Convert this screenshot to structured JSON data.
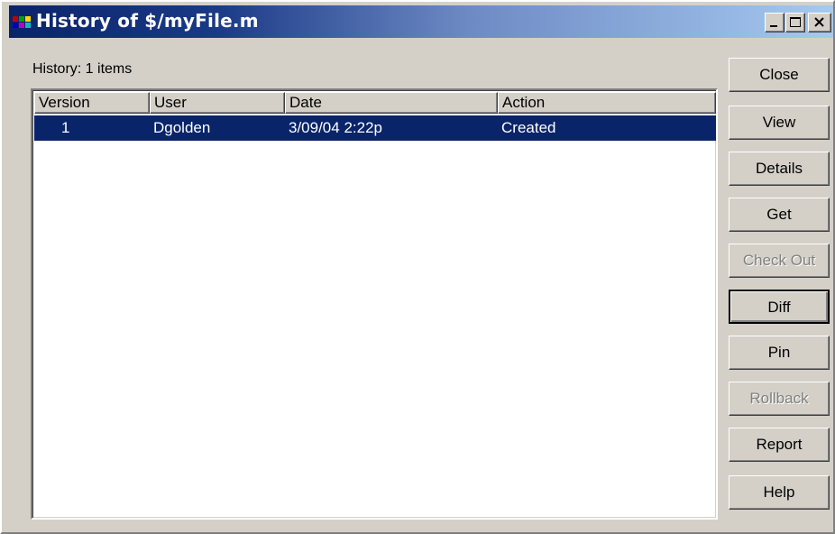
{
  "window": {
    "title": "History of $/myFile.m",
    "icon": "sourcesafe-app-icon"
  },
  "history": {
    "count_label": "History: 1 items"
  },
  "list": {
    "columns": [
      "Version",
      "User",
      "Date",
      "Action"
    ],
    "rows": [
      {
        "version": "1",
        "user": "Dgolden",
        "date": "3/09/04  2:22p",
        "action": "Created",
        "selected": true
      }
    ]
  },
  "buttons": {
    "close": "Close",
    "view": "View",
    "details": "Details",
    "get": "Get",
    "check_out": "Check Out",
    "diff": "Diff",
    "pin": "Pin",
    "rollback": "Rollback",
    "report": "Report",
    "help": "Help"
  },
  "colors": {
    "selection": "#0a246a",
    "titlebar_start": "#0a246a",
    "titlebar_end": "#a6caf0",
    "face": "#d4d0c8"
  }
}
